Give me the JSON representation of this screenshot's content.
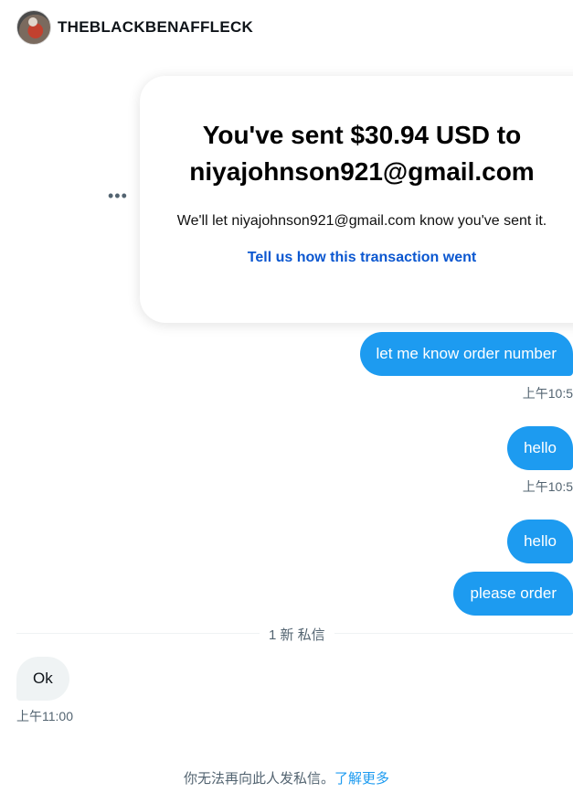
{
  "header": {
    "username": "THEBLACKBENAFFLECK"
  },
  "payment_card": {
    "title_line1": "You've sent $30.94 USD to",
    "title_line2": "niyajohnson921@gmail.com",
    "subtitle": "We'll let niyajohnson921@gmail.com know you've sent it.",
    "link_text": "Tell us how this transaction went"
  },
  "messages": [
    {
      "text": "let me know order number",
      "timestamp": "上午10:5"
    },
    {
      "text": "hello",
      "timestamp": "上午10:5"
    },
    {
      "text": "hello"
    },
    {
      "text": "please order"
    }
  ],
  "divider": {
    "label": "1 新 私信"
  },
  "incoming": {
    "text": "Ok",
    "timestamp": "上午11:00"
  },
  "footer": {
    "notice": "你无法再向此人发私信。",
    "link": "了解更多"
  },
  "colors": {
    "bubble_out": "#1d9bf0",
    "bubble_in": "#eff3f4",
    "link_blue": "#0b57d0"
  }
}
